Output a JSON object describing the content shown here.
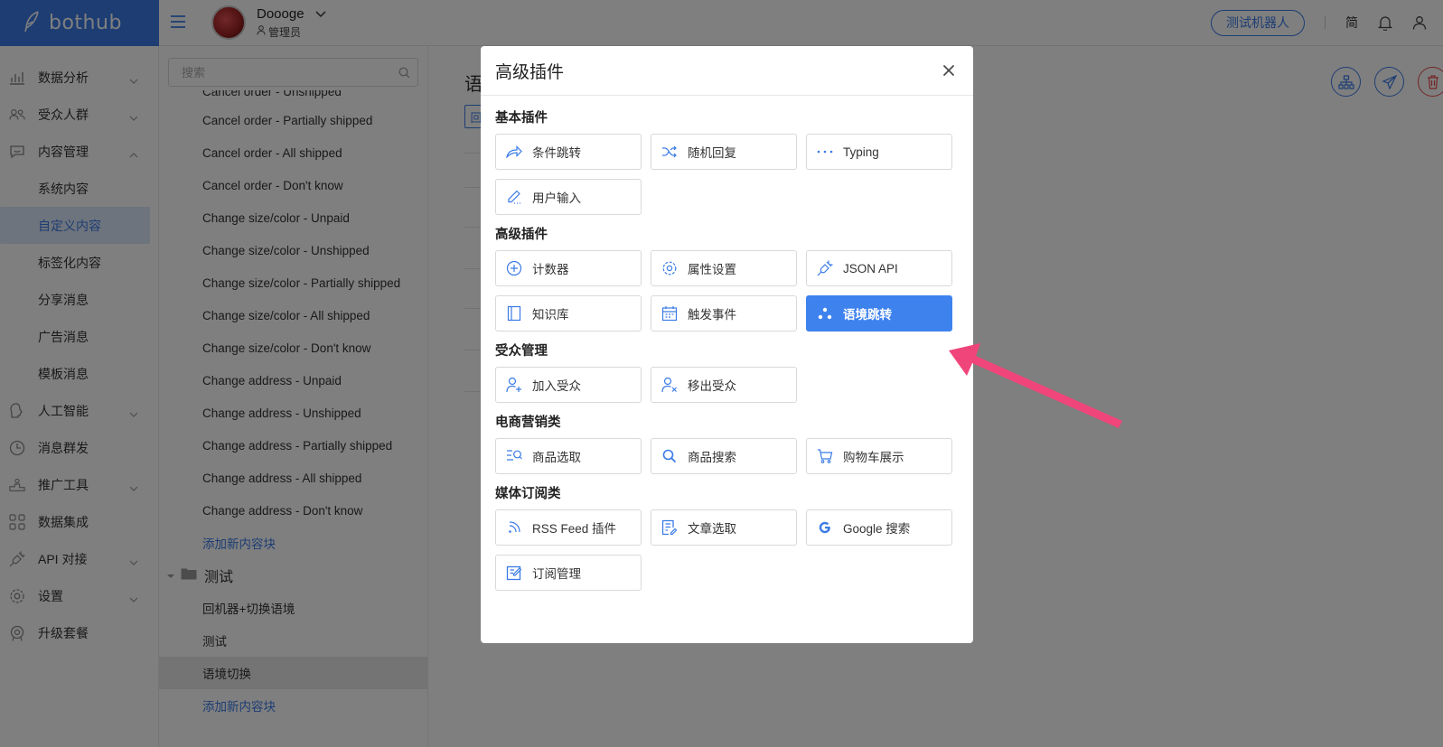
{
  "brand": {
    "name": "bothub"
  },
  "user": {
    "name": "Doooge",
    "role": "管理员"
  },
  "header": {
    "test_bot": "测试机器人",
    "lang": "简"
  },
  "sidebar": {
    "items": [
      {
        "label": "数据分析"
      },
      {
        "label": "受众人群"
      },
      {
        "label": "内容管理"
      },
      {
        "label": "系统内容"
      },
      {
        "label": "自定义内容"
      },
      {
        "label": "标签化内容"
      },
      {
        "label": "分享消息"
      },
      {
        "label": "广告消息"
      },
      {
        "label": "模板消息"
      },
      {
        "label": "人工智能"
      },
      {
        "label": "消息群发"
      },
      {
        "label": "推广工具"
      },
      {
        "label": "数据集成"
      },
      {
        "label": "API 对接"
      },
      {
        "label": "设置"
      },
      {
        "label": "升级套餐"
      }
    ]
  },
  "contentlist": {
    "search_placeholder": "搜索",
    "items": [
      "Cancel order - Unshipped",
      "Cancel order - Partially shipped",
      "Cancel order - All shipped",
      "Cancel order - Don't know",
      "Change size/color - Unpaid",
      "Change size/color - Unshipped",
      "Change size/color - Partially shipped",
      "Change size/color - All shipped",
      "Change size/color - Don't know",
      "Change address - Unpaid",
      "Change address - Unshipped",
      "Change address - Partially shipped",
      "Change address - All shipped",
      "Change address - Don't know"
    ],
    "add_new": "添加新内容块",
    "folder": "测试",
    "folder_items": [
      "回机器+切换语境",
      "测试",
      "语境切换"
    ],
    "add_new_2": "添加新内容块"
  },
  "main": {
    "title": "语",
    "tag": "回"
  },
  "modal": {
    "title": "高级插件",
    "sections": [
      {
        "title": "基本插件",
        "items": [
          "条件跳转",
          "随机回复",
          "Typing",
          "用户输入"
        ]
      },
      {
        "title": "高级插件",
        "items": [
          "计数器",
          "属性设置",
          "JSON API",
          "知识库",
          "触发事件",
          "语境跳转"
        ]
      },
      {
        "title": "受众管理",
        "items": [
          "加入受众",
          "移出受众"
        ]
      },
      {
        "title": "电商营销类",
        "items": [
          "商品选取",
          "商品搜索",
          "购物车展示"
        ]
      },
      {
        "title": "媒体订阅类",
        "items": [
          "RSS Feed 插件",
          "文章选取",
          "Google 搜索",
          "订阅管理"
        ]
      }
    ]
  },
  "colors": {
    "primary": "#3a7be6",
    "active_button": "#3e82ee",
    "annotation": "#f0457a",
    "danger": "#e84a4a"
  }
}
